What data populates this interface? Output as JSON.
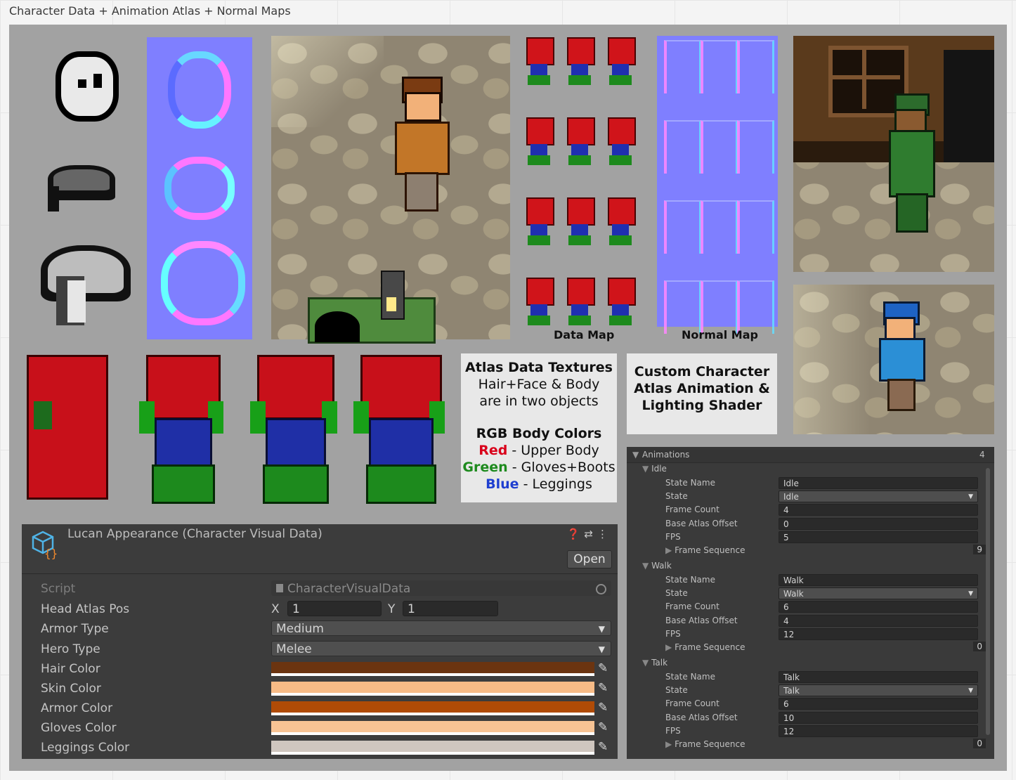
{
  "page": {
    "title": "Character Data + Animation Atlas + Normal Maps"
  },
  "maps": {
    "data_label": "Data Map",
    "normal_label": "Normal Map"
  },
  "atlas_box": {
    "title": "Atlas Data Textures",
    "line1": "Hair+Face & Body",
    "line2": "are in two objects",
    "rgb_title": "RGB Body Colors",
    "red_word": "Red",
    "red_desc": " - Upper Body",
    "green_word": "Green",
    "green_desc": " - Gloves+Boots",
    "blue_word": "Blue",
    "blue_desc": " - Leggings",
    "colors": {
      "red": "#d9001a",
      "green": "#1d8a1d",
      "blue": "#1f3fd0"
    }
  },
  "custom_box": {
    "line1": "Custom Character",
    "line2": "Atlas Animation &",
    "line3": "Lighting Shader"
  },
  "inspector": {
    "title": "Lucan Appearance (Character Visual Data)",
    "open_label": "Open",
    "script_label": "Script",
    "script_value": "CharacterVisualData",
    "head_atlas_label": "Head Atlas Pos",
    "x_label": "X",
    "x_value": "1",
    "y_label": "Y",
    "y_value": "1",
    "armor_type_label": "Armor Type",
    "armor_type_value": "Medium",
    "hero_type_label": "Hero Type",
    "hero_type_value": "Melee",
    "colors": [
      {
        "label": "Hair Color",
        "value": "#6b3410"
      },
      {
        "label": "Skin Color",
        "value": "#f7bb86"
      },
      {
        "label": "Armor Color",
        "value": "#b04b06"
      },
      {
        "label": "Gloves Color",
        "value": "#f7c394"
      },
      {
        "label": "Leggings Color",
        "value": "#cfc6bf"
      }
    ]
  },
  "animations": {
    "title": "Animations",
    "count": "4",
    "field_labels": {
      "state_name": "State Name",
      "state": "State",
      "frame_count": "Frame Count",
      "base_offset": "Base Atlas Offset",
      "fps": "FPS",
      "frame_sequence": "Frame Sequence"
    },
    "items": [
      {
        "name": "Idle",
        "state_name": "Idle",
        "state": "Idle",
        "frame_count": "4",
        "base_offset": "0",
        "fps": "5",
        "sequence": "9"
      },
      {
        "name": "Walk",
        "state_name": "Walk",
        "state": "Walk",
        "frame_count": "6",
        "base_offset": "4",
        "fps": "12",
        "sequence": "0"
      },
      {
        "name": "Talk",
        "state_name": "Talk",
        "state": "Talk",
        "frame_count": "6",
        "base_offset": "10",
        "fps": "12",
        "sequence": "0"
      }
    ]
  }
}
